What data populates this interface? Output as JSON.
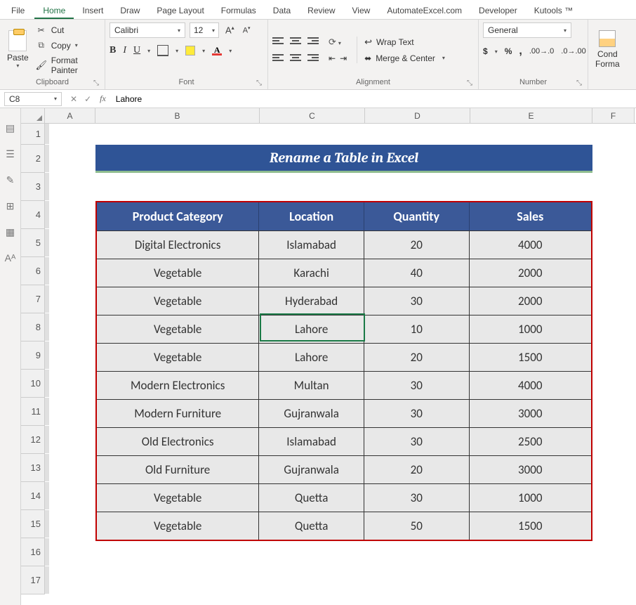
{
  "tabs": {
    "file": "File",
    "home": "Home",
    "insert": "Insert",
    "draw": "Draw",
    "pagelayout": "Page Layout",
    "formulas": "Formulas",
    "data": "Data",
    "review": "Review",
    "view": "View",
    "automateexcel": "AutomateExcel.com",
    "developer": "Developer",
    "kutools": "Kutools ™"
  },
  "ribbon": {
    "clipboard": {
      "paste": "Paste",
      "cut": "Cut",
      "copy": "Copy",
      "formatpainter": "Format Painter",
      "label": "Clipboard"
    },
    "font": {
      "name": "Calibri",
      "size": "12",
      "label": "Font"
    },
    "alignment": {
      "wrap": "Wrap Text",
      "merge": "Merge & Center",
      "label": "Alignment"
    },
    "number": {
      "format": "General",
      "label": "Number"
    },
    "styles": {
      "cond1": "Cond",
      "cond2": "Forma"
    }
  },
  "namebox": "C8",
  "formula": "Lahore",
  "columns": [
    "A",
    "B",
    "C",
    "D",
    "E",
    "F"
  ],
  "rows": [
    "1",
    "2",
    "3",
    "4",
    "5",
    "6",
    "7",
    "8",
    "9",
    "10",
    "11",
    "12",
    "13",
    "14",
    "15",
    "16",
    "17"
  ],
  "title": "Rename a Table in Excel",
  "table_headers": {
    "B": "Product Category",
    "C": "Location",
    "D": "Quantity",
    "E": "Sales"
  },
  "table_rows": [
    {
      "B": "Digital Electronics",
      "C": "Islamabad",
      "D": "20",
      "E": "4000"
    },
    {
      "B": "Vegetable",
      "C": "Karachi",
      "D": "40",
      "E": "2000"
    },
    {
      "B": "Vegetable",
      "C": "Hyderabad",
      "D": "30",
      "E": "2000"
    },
    {
      "B": "Vegetable",
      "C": "Lahore",
      "D": "10",
      "E": "1000"
    },
    {
      "B": "Vegetable",
      "C": "Lahore",
      "D": "20",
      "E": "1500"
    },
    {
      "B": "Modern Electronics",
      "C": "Multan",
      "D": "30",
      "E": "4000"
    },
    {
      "B": "Modern Furniture",
      "C": "Gujranwala",
      "D": "30",
      "E": "3000"
    },
    {
      "B": "Old Electronics",
      "C": "Islamabad",
      "D": "30",
      "E": "2500"
    },
    {
      "B": "Old Furniture",
      "C": "Gujranwala",
      "D": "20",
      "E": "3000"
    },
    {
      "B": "Vegetable",
      "C": "Quetta",
      "D": "30",
      "E": "1000"
    },
    {
      "B": "Vegetable",
      "C": "Quetta",
      "D": "50",
      "E": "1500"
    }
  ]
}
